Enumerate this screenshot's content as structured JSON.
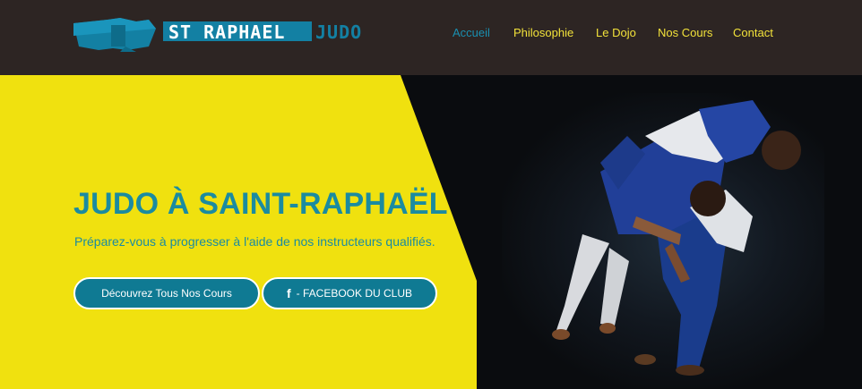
{
  "header": {
    "logo": {
      "text_left": "ST RAPHAEL",
      "text_right": "JUDO"
    },
    "nav": [
      {
        "label": "Accueil",
        "active": true
      },
      {
        "label": "Philosophie",
        "active": false
      },
      {
        "label": "Le Dojo",
        "active": false
      },
      {
        "label": "Nos Cours",
        "active": false
      },
      {
        "label": "Contact",
        "active": false
      }
    ]
  },
  "hero": {
    "title": "JUDO À SAINT-RAPHAËL",
    "subtitle": "Préparez-vous à progresser à l'aide de nos instructeurs qualifiés.",
    "buttons": {
      "courses_label": "Découvrez Tous Nos Cours",
      "facebook_icon": "facebook-icon",
      "facebook_label": "- FACEBOOK DU CLUB"
    }
  },
  "colors": {
    "header_bg": "#2d2523",
    "nav_text": "#f2e23a",
    "nav_active": "#1a8fb0",
    "hero_yellow": "#f0e10f",
    "accent_teal": "#1b8ba0",
    "button_bg": "#0f7a93"
  }
}
